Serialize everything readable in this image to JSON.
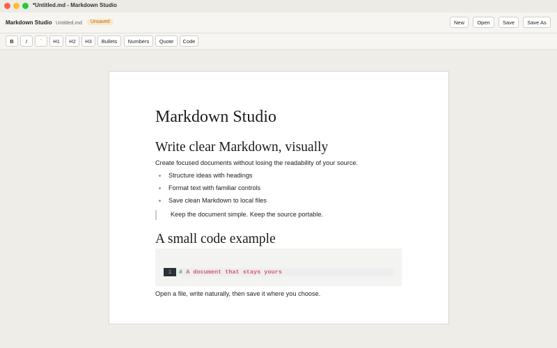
{
  "window": {
    "title": "*Untitled.md - Markdown Studio"
  },
  "header": {
    "app_name": "Markdown Studio",
    "file_name": "Untitled.md",
    "status_badge": "Unsaved",
    "buttons": {
      "new": "New",
      "open": "Open",
      "save": "Save",
      "save_as": "Save As"
    }
  },
  "toolbar": {
    "bold": "B",
    "italic": "I",
    "code_inline": "`",
    "h1": "H1",
    "h2": "H2",
    "h3": "H3",
    "bullets": "Bullets",
    "numbers": "Numbers",
    "quote": "Quote",
    "code": "Code"
  },
  "document": {
    "title": "Markdown Studio",
    "heading_1": "Write clear Markdown, visually",
    "intro": "Create focused documents without losing the readability of your source.",
    "bullets": [
      "Structure ideas with headings",
      "Format text with familiar controls",
      "Save clean Markdown to local files"
    ],
    "blockquote": "Keep the document simple. Keep the source portable.",
    "heading_2": "A small code example",
    "code": {
      "line_number": "1",
      "hash": "#",
      "text": " A document that stays yours"
    },
    "closing": "Open a file, write naturally, then save it where you choose."
  },
  "colors": {
    "accent_badge_bg": "#fbe8c8",
    "accent_badge_fg": "#b36b14",
    "code_text": "#d65a6a",
    "code_hash": "#4fa163"
  }
}
